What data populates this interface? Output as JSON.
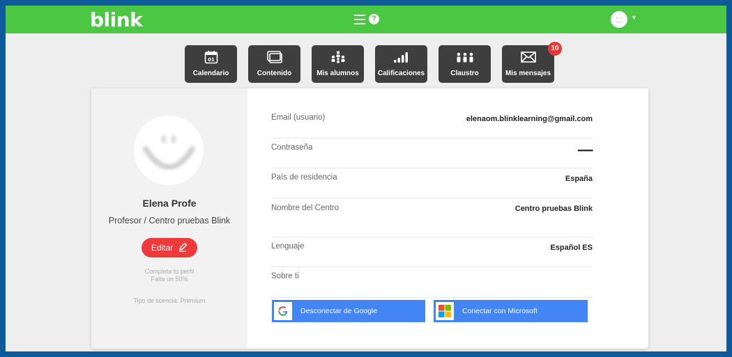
{
  "header": {
    "logo": "blink",
    "help": "?",
    "caret": "▼"
  },
  "nav": [
    {
      "label": "Calendario",
      "icon": "calendar-icon",
      "icon_text": "01"
    },
    {
      "label": "Contenido",
      "icon": "screens-icon"
    },
    {
      "label": "Mis alumnos",
      "icon": "students-icon"
    },
    {
      "label": "Calificaciones",
      "icon": "grades-icon"
    },
    {
      "label": "Claustro",
      "icon": "faculty-icon"
    },
    {
      "label": "Mis mensajes",
      "icon": "envelope-icon"
    }
  ],
  "messages_badge": "10",
  "profile": {
    "name": "Elena Profe",
    "role": "Profesor / Centro pruebas Blink",
    "edit_label": "Editar",
    "completion_line1": "Completa tu perfil",
    "completion_line2": "Falta un 50%",
    "license": "Tipo de licencia: Premium"
  },
  "fields": [
    {
      "label": "Email (usuario)",
      "value": "elenaom.blinklearning@gmail.com"
    },
    {
      "label": "Contraseña",
      "value": "••••••••••"
    },
    {
      "label": "País de residencia",
      "value": "España"
    },
    {
      "label": "Nombre del Centro",
      "value": "Centro pruebas Blink"
    },
    {
      "label": "Lenguaje",
      "value": "Español ES"
    },
    {
      "label": "Sobre ti",
      "value": ""
    }
  ],
  "buttons": {
    "google": "Desconectar de Google",
    "microsoft": "Conectar con Microsoft"
  },
  "colors": {
    "brand_green": "#4cc744",
    "nav_dark": "#3e3e3e",
    "edit_red": "#ee3a3a",
    "button_blue": "#4285f4",
    "outer_border": "#0e5a9a"
  }
}
